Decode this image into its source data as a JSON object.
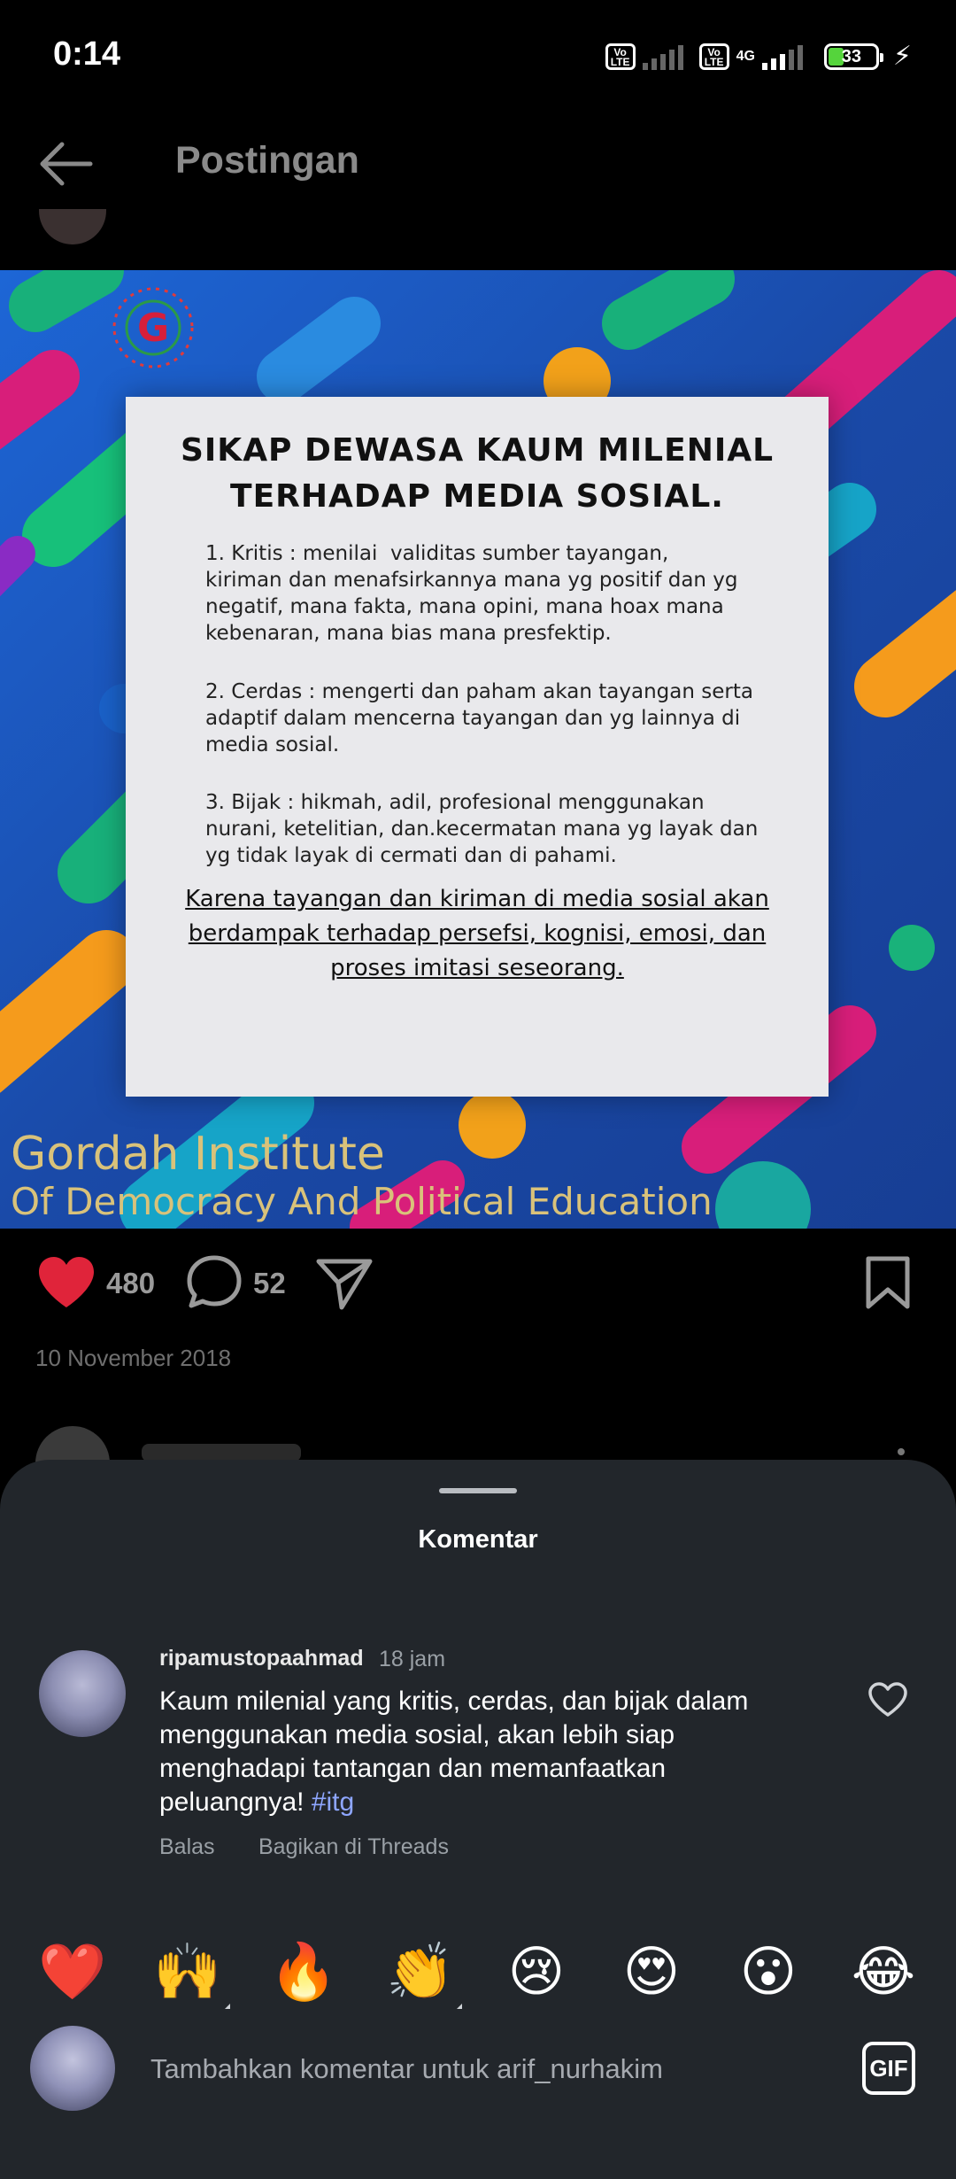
{
  "status_bar": {
    "time": "0:14",
    "volte_label": "Vo LTE",
    "network_type": "4G",
    "battery_level": "33",
    "battery_percent": 33
  },
  "header": {
    "title": "Postingan",
    "back_icon": "arrow-left-icon"
  },
  "post": {
    "image": {
      "card_title": "SIKAP DEWASA KAUM MILENIAL\nTERHADAP MEDIA SOSIAL.",
      "points": [
        "1. Kritis : menilai  validitas sumber tayangan,\nkiriman dan menafsirkannya mana yg positif dan yg\nnegatif, mana fakta, mana opini, mana hoax mana\nkebenaran, mana bias mana presfektip.",
        "2. Cerdas : mengerti dan paham akan tayangan serta\nadaptif dalam mencerna tayangan dan yg lainnya di\nmedia sosial.",
        "3. Bijak : hikmah, adil, profesional menggunakan\nnurani, ketelitian, dan.kecermatan mana yg layak dan\nyg tidak layak di cermati dan di pahami."
      ],
      "footer_text": "Karena tayangan dan kiriman di media sosial akan\nberdampak terhadap persefsi, kognisi, emosi, dan\nproses imitasi seseorang.",
      "brand_line1": "Gordah Institute",
      "brand_line2": "Of Democracy And Political Education"
    },
    "likes": "480",
    "comments": "52",
    "date": "10 November 2018",
    "liked": true,
    "colors": {
      "like_red": "#e0243a",
      "hashtag": "#8ea6ff",
      "sheet_bg": "#22262b"
    }
  },
  "comment_sheet": {
    "title": "Komentar",
    "comment": {
      "username": "ripamustopaahmad",
      "time": "18 jam",
      "text": "Kaum milenial yang kritis, cerdas, dan bijak dalam menggunakan media sosial, akan lebih siap menghadapi tantangan dan memanfaatkan peluangnya! ",
      "hashtag": "#itg",
      "reply_label": "Balas",
      "share_label": "Bagikan di Threads"
    },
    "emoji_bar": [
      "❤️",
      "🙌",
      "🔥",
      "👏",
      "😢",
      "😍",
      "😮",
      "😂"
    ],
    "input_placeholder": "Tambahkan komentar untuk arif_nurhakim",
    "gif_label": "GIF"
  }
}
